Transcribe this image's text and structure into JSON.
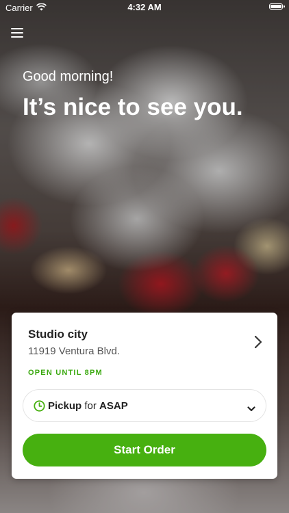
{
  "status_bar": {
    "carrier": "Carrier",
    "time": "4:32 AM"
  },
  "hero": {
    "greeting": "Good morning!",
    "headline": "It’s nice to see you."
  },
  "location": {
    "name": "Studio city",
    "address": "11919 Ventura Blvd.",
    "hours_status": "OPEN UNTIL 8PM"
  },
  "order_type": {
    "mode": "Pickup",
    "connector": "for",
    "time": "ASAP"
  },
  "actions": {
    "start_order_label": "Start Order"
  },
  "colors": {
    "accent": "#47b010",
    "status_open": "#3aa80f"
  },
  "icons": {
    "menu": "hamburger-menu-icon",
    "wifi": "wifi-icon",
    "battery": "battery-icon",
    "store_chevron": "chevron-right-icon",
    "clock": "clock-icon",
    "dropdown": "chevron-down-icon"
  }
}
